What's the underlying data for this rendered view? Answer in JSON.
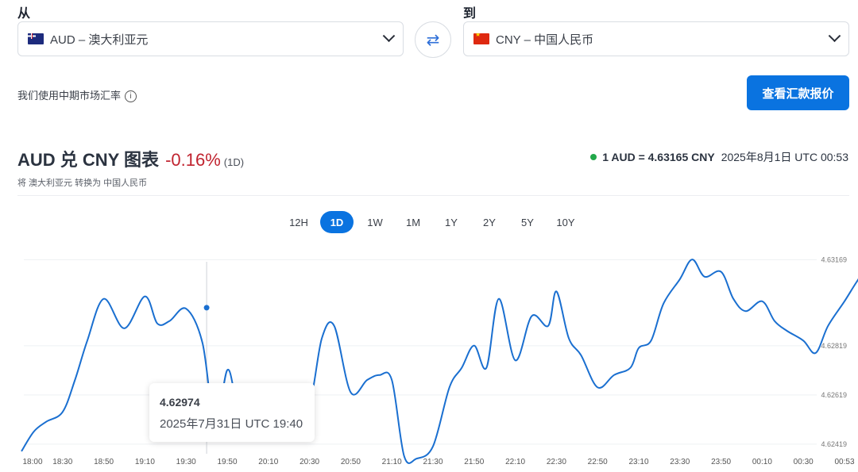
{
  "from": {
    "label": "从",
    "currency": "AUD – 澳大利亚元",
    "flag": "au-flag"
  },
  "to": {
    "label": "到",
    "currency": "CNY – 中国人民币",
    "flag": "cn-flag"
  },
  "swap_icon": "⇄",
  "mid_rate_note": "我们使用中期市场汇率",
  "info_icon": "i",
  "cta": "查看汇款报价",
  "chart_header": {
    "title": "AUD 兑 CNY 图表",
    "change": "-0.16%",
    "period": "(1D)",
    "subtitle": "将 澳大利亚元 转换为 中国人民币",
    "rate": "1 AUD = 4.63165 CNY",
    "timestamp": "2025年8月1日 UTC 00:53"
  },
  "ranges": [
    "12H",
    "1D",
    "1W",
    "1M",
    "1Y",
    "2Y",
    "5Y",
    "10Y"
  ],
  "active_range": "1D",
  "tooltip": {
    "value": "4.62974",
    "date": "2025年7月31日 UTC 19:40"
  },
  "colors": {
    "accent": "#0a73e0",
    "line": "#1a6fd0",
    "negative": "#c0232f",
    "live": "#22a84a"
  },
  "chart_data": {
    "type": "line",
    "y_ticks": [
      "4.63169",
      "4.62819",
      "4.62619",
      "4.62419"
    ],
    "ylim": [
      4.6238,
      4.6318
    ],
    "x_ticks": [
      "18:00",
      "18:30",
      "18:50",
      "19:10",
      "19:30",
      "19:50",
      "20:10",
      "20:30",
      "20:50",
      "21:10",
      "21:30",
      "21:50",
      "22:10",
      "22:30",
      "22:50",
      "23:10",
      "23:30",
      "23:50",
      "00:10",
      "00:30",
      "00:53"
    ],
    "grid": true,
    "series": [
      {
        "x_index": [
          0,
          0.3,
          0.6,
          1.0,
          1.3,
          1.6,
          2.0,
          2.5,
          3.0,
          3.3,
          3.6,
          4.0,
          4.4,
          4.7,
          5.0,
          5.2,
          5.4,
          5.6,
          6.0,
          6.3,
          6.6,
          7.0,
          7.3,
          7.6,
          8.0,
          8.4,
          8.7,
          9.0,
          9.3,
          9.6,
          10.0,
          10.4,
          10.7,
          11.0,
          11.3,
          11.6,
          12.0,
          12.4,
          12.8,
          13.0,
          13.3,
          13.6,
          14.0,
          14.4,
          14.8,
          15.0,
          15.3,
          15.6,
          16.0,
          16.3,
          16.6,
          17.0,
          17.3,
          17.6,
          18.0,
          18.3,
          18.6,
          19.0,
          19.3,
          19.6,
          20.0,
          20.3,
          20.6,
          21.0
        ],
        "values": [
          4.6239,
          4.6247,
          4.6251,
          4.6255,
          4.6268,
          4.6284,
          4.6301,
          4.6289,
          4.6302,
          4.6291,
          4.6292,
          4.6297,
          4.6283,
          4.625,
          4.6272,
          4.6261,
          4.6252,
          4.6262,
          4.6262,
          4.6252,
          4.6252,
          4.6258,
          4.6285,
          4.629,
          4.6263,
          4.6268,
          4.627,
          4.6268,
          4.6237,
          4.6236,
          4.6241,
          4.6265,
          4.6273,
          4.6282,
          4.6273,
          4.6301,
          4.6276,
          4.6294,
          4.629,
          4.6304,
          4.6285,
          4.6278,
          4.6265,
          4.627,
          4.6273,
          4.6281,
          4.6284,
          4.6299,
          4.6309,
          4.6317,
          4.631,
          4.6312,
          4.6301,
          4.6296,
          4.63,
          4.6292,
          4.6288,
          4.6284,
          4.6279,
          4.629,
          4.63,
          4.6308,
          4.6315,
          4.6317
        ]
      }
    ]
  }
}
